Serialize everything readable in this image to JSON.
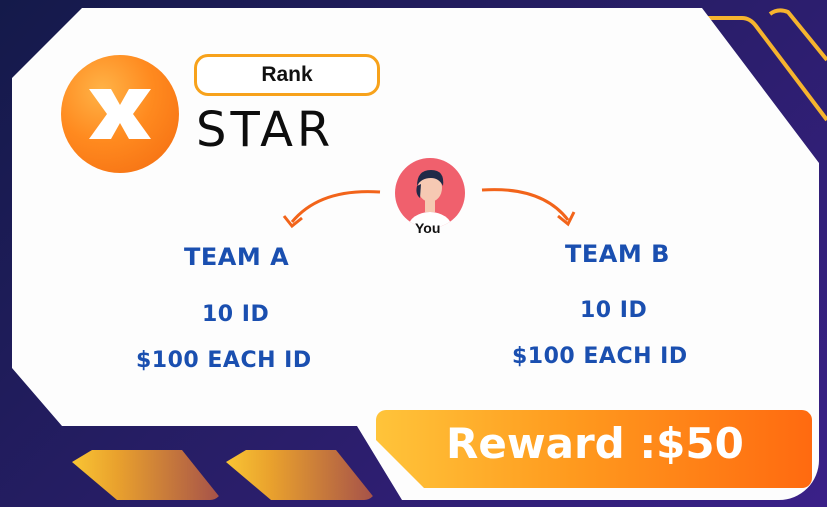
{
  "rank": {
    "badge_label": "Rank",
    "title": "STAR"
  },
  "center": {
    "you_label": "You"
  },
  "teams": [
    {
      "name": "TEAM A",
      "ids": "10 ID",
      "price": "$100 EACH ID"
    },
    {
      "name": "TEAM B",
      "ids": "10 ID",
      "price": "$100 EACH ID"
    }
  ],
  "reward": {
    "text": "Reward :$50"
  },
  "colors": {
    "background_dark": "#1b1f5a",
    "accent_orange": "#ff8a1f",
    "accent_yellow": "#f7a21b",
    "team_blue": "#1a4fb0",
    "avatar_bg": "#f0606d"
  },
  "icons": {
    "logo": "x-logo-icon",
    "avatar": "user-avatar-icon",
    "arrows": "curved-arrow-icon"
  }
}
